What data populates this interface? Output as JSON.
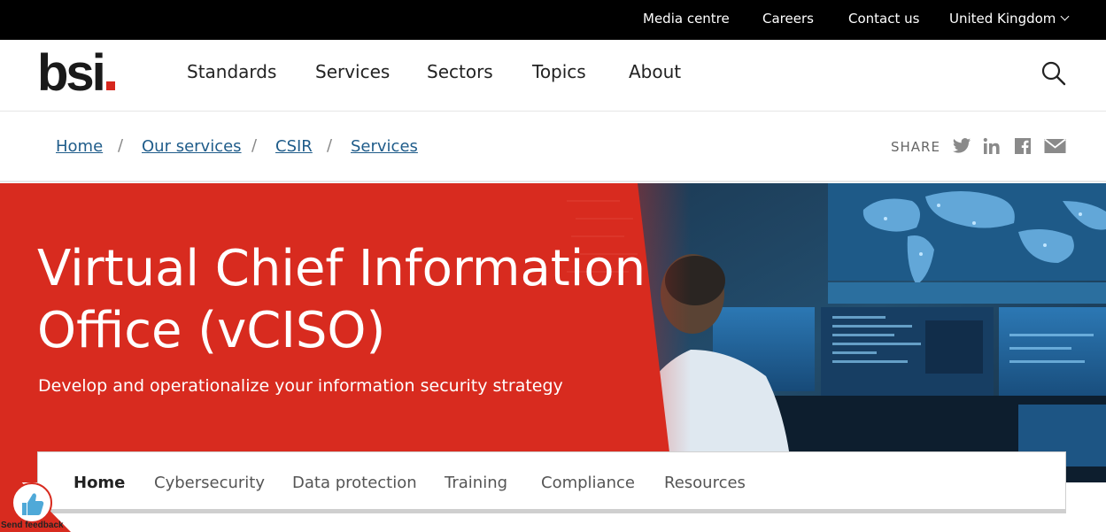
{
  "utility_nav": {
    "media_centre": "Media centre",
    "careers": "Careers",
    "contact_us": "Contact us",
    "region": "United Kingdom"
  },
  "header": {
    "logo_text": "bsi",
    "nav": [
      "Standards",
      "Services",
      "Sectors",
      "Topics",
      "About"
    ]
  },
  "breadcrumb": {
    "items": [
      "Home",
      "Our services",
      "CSIR",
      "Services"
    ],
    "separator": "/"
  },
  "share": {
    "label": "SHARE",
    "icons": [
      "twitter-icon",
      "linkedin-icon",
      "facebook-icon",
      "email-icon"
    ]
  },
  "hero": {
    "title": "Virtual Chief Information Office (vCISO)",
    "subtitle": "Develop and operationalize your information security strategy"
  },
  "subnav": {
    "items": [
      "Home",
      "Cybersecurity",
      "Data protection",
      "Training",
      "Compliance",
      "Resources"
    ],
    "active": "Home"
  },
  "feedback": {
    "label": "Send feedback"
  },
  "colors": {
    "brand_red": "#d82b1f",
    "link_blue": "#1f5c8a",
    "top_bar": "#000000"
  }
}
